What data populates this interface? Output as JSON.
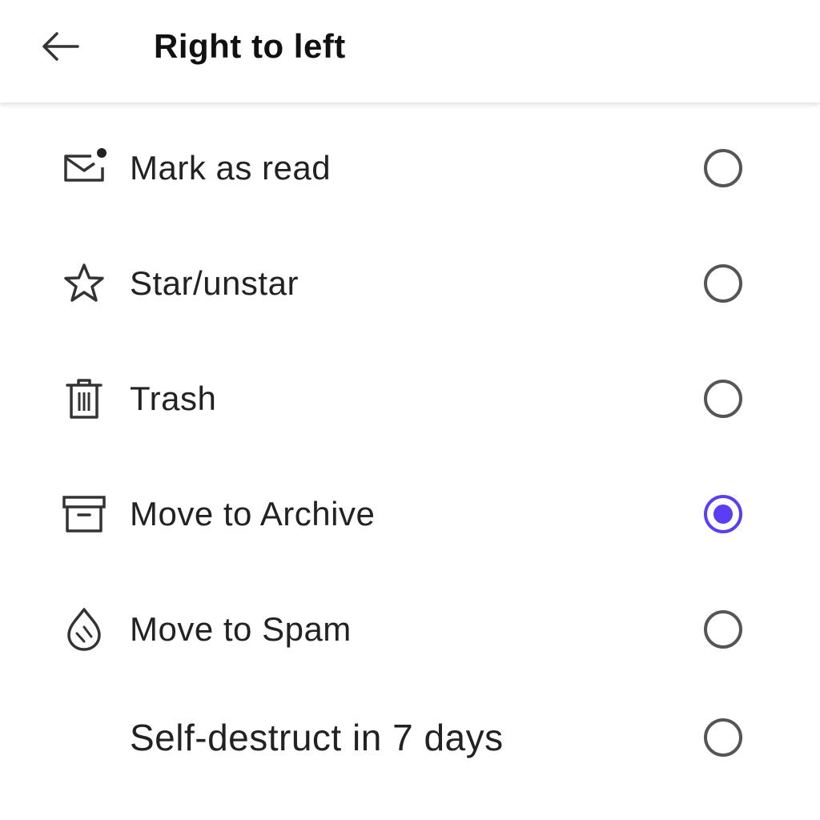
{
  "header": {
    "title": "Right to left",
    "back_icon": "arrow-left-icon"
  },
  "accent_color": "#5b3df5",
  "options": [
    {
      "label": "Mark as read",
      "icon": "mail-unread-icon",
      "selected": false
    },
    {
      "label": "Star/unstar",
      "icon": "star-icon",
      "selected": false
    },
    {
      "label": "Trash",
      "icon": "trash-icon",
      "selected": false
    },
    {
      "label": "Move to Archive",
      "icon": "archive-icon",
      "selected": true
    },
    {
      "label": "Move to Spam",
      "icon": "spam-icon",
      "selected": false
    },
    {
      "label": "Self-destruct in 7 days",
      "icon": "",
      "selected": false
    }
  ]
}
